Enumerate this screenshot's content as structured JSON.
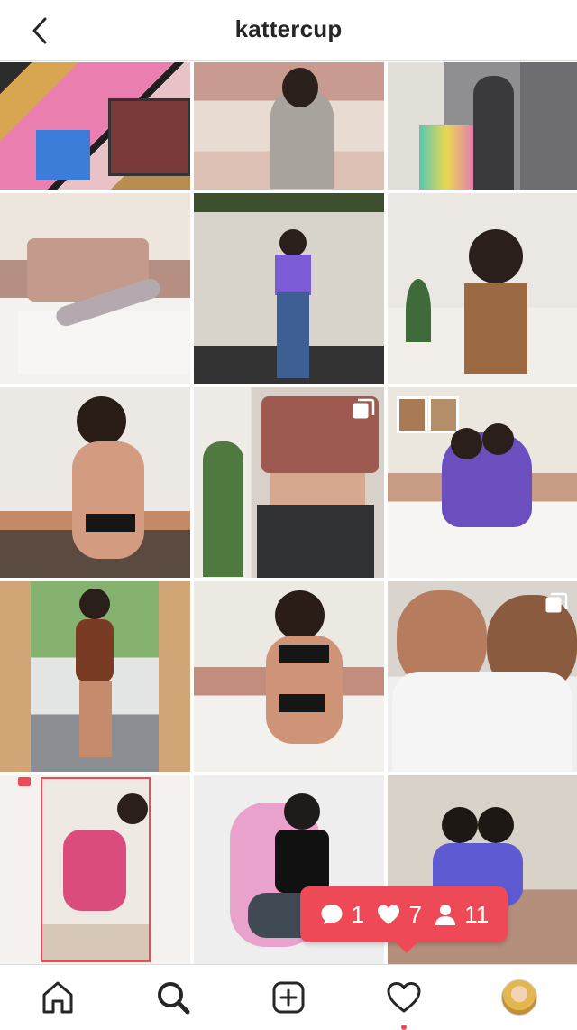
{
  "header": {
    "title": "kattercup",
    "back_icon": "chevron-left-icon"
  },
  "grid": {
    "tiles": [
      {
        "name": "post-1",
        "bg": "#c98f9a",
        "multiple": false
      },
      {
        "name": "post-2",
        "bg": "#cdb0a0",
        "multiple": false
      },
      {
        "name": "post-3",
        "bg": "#b9b6ad",
        "multiple": false
      },
      {
        "name": "post-4",
        "bg": "#e6ded3",
        "multiple": false
      },
      {
        "name": "post-5",
        "bg": "#c9c6be",
        "multiple": false
      },
      {
        "name": "post-6",
        "bg": "#e3e0dc",
        "multiple": false
      },
      {
        "name": "post-7",
        "bg": "#e4ded5",
        "multiple": false
      },
      {
        "name": "post-8",
        "bg": "#dcd6cf",
        "multiple": true
      },
      {
        "name": "post-9",
        "bg": "#e8e3da",
        "multiple": false
      },
      {
        "name": "post-10",
        "bg": "#d1a677",
        "multiple": false
      },
      {
        "name": "post-11",
        "bg": "#e9e5df",
        "multiple": false
      },
      {
        "name": "post-12",
        "bg": "#c7bcb3",
        "multiple": true
      },
      {
        "name": "post-13",
        "bg": "#f4f1ee",
        "multiple": false
      },
      {
        "name": "post-14",
        "bg": "#eeeeee",
        "multiple": false
      },
      {
        "name": "post-15",
        "bg": "#dcd5ce",
        "multiple": false
      }
    ]
  },
  "activity": {
    "comments": "1",
    "likes": "7",
    "follows": "11"
  },
  "bottom_nav": {
    "items": [
      "home-icon",
      "search-icon",
      "add-post-icon",
      "heart-icon",
      "profile-avatar"
    ]
  },
  "colors": {
    "accent": "#ed4956",
    "text": "#262626",
    "divider": "#dbdbdb"
  }
}
